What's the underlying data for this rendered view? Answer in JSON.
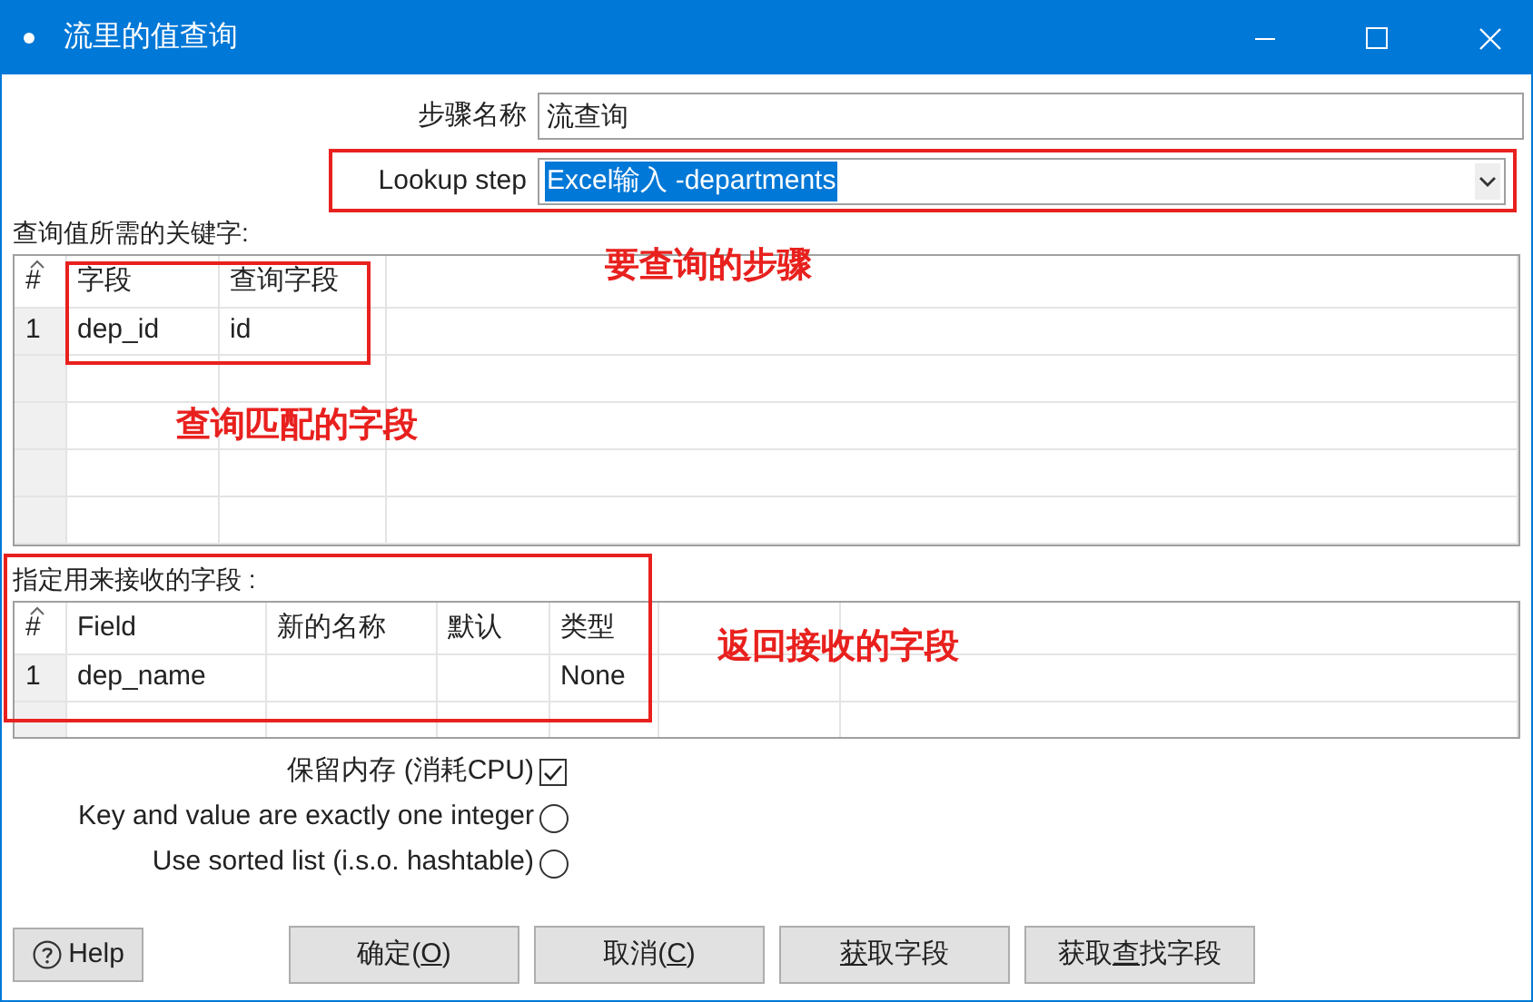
{
  "window": {
    "title": "流里的值查询"
  },
  "step_name": {
    "label": "步骤名称",
    "value": "流查询"
  },
  "lookup_step": {
    "label": "Lookup step",
    "value": "Excel输入 -departments",
    "selected": true
  },
  "keys_table": {
    "label": "查询值所需的关键字:",
    "columns": [
      "#",
      "字段",
      "查询字段"
    ],
    "rows": [
      [
        "1",
        "dep_id",
        "id"
      ]
    ]
  },
  "return_table": {
    "label": "指定用来接收的字段 :",
    "columns": [
      "#",
      "Field",
      "新的名称",
      "默认",
      "类型"
    ],
    "rows": [
      [
        "1",
        "dep_name",
        "",
        "",
        "None"
      ]
    ]
  },
  "options": [
    {
      "kind": "checkbox",
      "label": "保留内存 (消耗CPU)",
      "checked": true
    },
    {
      "kind": "radio",
      "label": "Key and value are exactly one integer",
      "checked": false
    },
    {
      "kind": "radio",
      "label": "Use sorted list (i.s.o. hashtable)",
      "checked": false
    }
  ],
  "help_button": {
    "label": "Help"
  },
  "buttons": [
    {
      "before": "确定(",
      "key": "O",
      "after": ")"
    },
    {
      "before": "取消(",
      "key": "C",
      "after": ")"
    },
    {
      "key": "获",
      "after": "取字段"
    },
    {
      "before": "获取",
      "key": "查",
      "after": "找字段"
    }
  ],
  "annotations": [
    "要查询的步骤",
    "查询匹配的字段",
    "返回接收的字段"
  ]
}
